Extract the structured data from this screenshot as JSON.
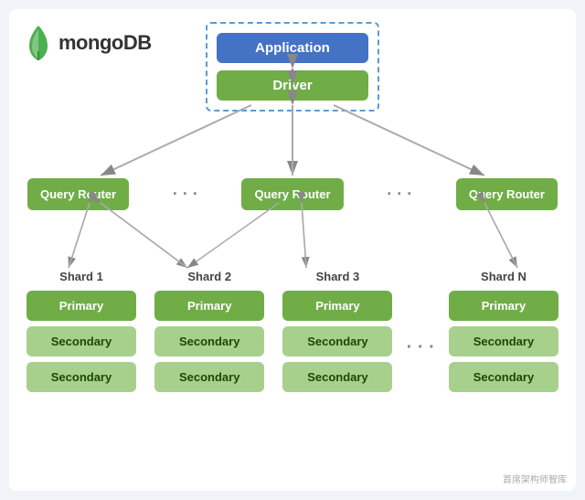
{
  "logo": {
    "text": "mongoDB"
  },
  "app_driver": {
    "application_label": "Application",
    "driver_label": "Driver"
  },
  "query_routers": {
    "label": "Query Router",
    "items": [
      "Query Router",
      "Query Router",
      "Query Router"
    ]
  },
  "shards": [
    {
      "label": "Shard 1",
      "primary": "Primary",
      "secondary1": "Secondary",
      "secondary2": "Secondary"
    },
    {
      "label": "Shard 2",
      "primary": "Primary",
      "secondary1": "Secondary",
      "secondary2": "Secondary"
    },
    {
      "label": "Shard 3",
      "primary": "Primary",
      "secondary1": "Secondary",
      "secondary2": "Secondary"
    },
    {
      "label": "Shard N",
      "primary": "Primary",
      "secondary1": "Secondary",
      "secondary2": "Secondary"
    }
  ],
  "watermark": "首席架构师智库"
}
